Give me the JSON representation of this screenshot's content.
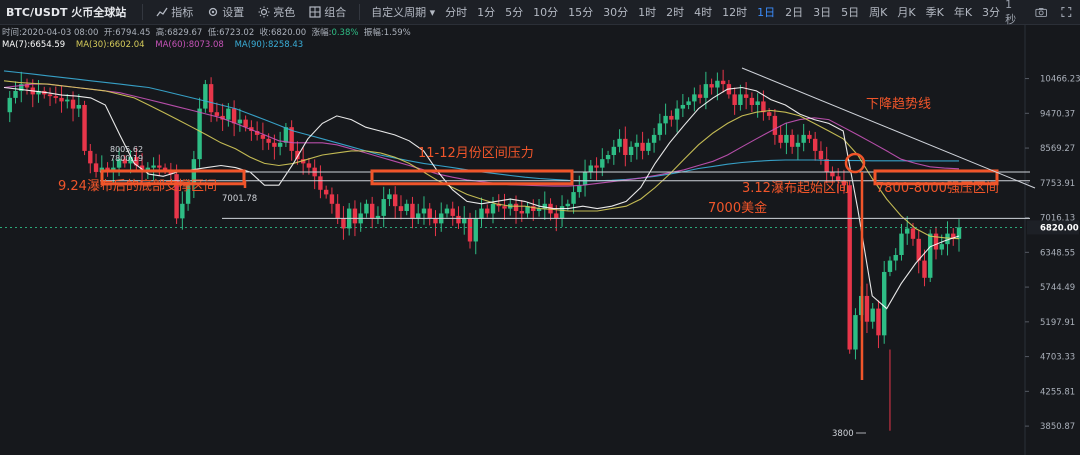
{
  "toolbar": {
    "symbol": "BTC/USDT 火币全球站",
    "indicators": "指标",
    "settings": "设置",
    "theme": "亮色",
    "combo": "组合",
    "custom_period": "自定义周期",
    "periods": [
      "分时",
      "1分",
      "5分",
      "10分",
      "15分",
      "30分",
      "1时",
      "2时",
      "4时",
      "12时",
      "1日",
      "2日",
      "3日",
      "5日",
      "周K",
      "月K",
      "季K",
      "年K",
      "3分"
    ],
    "active_period": "1日",
    "interval": "1秒"
  },
  "info": {
    "time": "时间:2020-04-03 08:00",
    "open": "开:6794.45",
    "high": "高:6829.67",
    "low": "低:6723.02",
    "close": "收:6820.00",
    "change_label": "涨幅:",
    "change": "0.38%",
    "amplitude": "振幅:1.59%"
  },
  "ma": [
    {
      "label": "MA(7):6654.59",
      "color": "#ffffff"
    },
    {
      "label": "MA(30):6602.04",
      "color": "#d6cc5a"
    },
    {
      "label": "MA(60):8073.08",
      "color": "#c653b8"
    },
    {
      "label": "MA(90):8258.43",
      "color": "#3aaed8"
    }
  ],
  "colors": {
    "up": "#2ebd85",
    "down": "#e8364a",
    "annotation": "#f0552a",
    "current_price": "#2ebd85"
  },
  "chart_data": {
    "type": "candlestick",
    "y_axis_ticks": [
      "10466.23",
      "9470.37",
      "8569.27",
      "7753.91",
      "7016.13",
      "6348.55",
      "5744.49",
      "5197.91",
      "4703.33",
      "4255.81",
      "3850.87"
    ],
    "current_price": "6820.00",
    "axis_scale": "log",
    "ylim": [
      3700,
      11200
    ],
    "ma7": [
      10200,
      10150,
      10100,
      10050,
      9980,
      9950,
      9900,
      9700,
      8900,
      8200,
      7950,
      7900,
      8000,
      8050,
      8100,
      8150,
      8100,
      8000,
      7700,
      7700,
      8200,
      8800,
      9200,
      9400,
      9300,
      9100,
      9000,
      8900,
      8750,
      8500,
      8000,
      7600,
      7350,
      7300,
      7350,
      7400,
      7350,
      7250,
      7200,
      7200,
      7250,
      7200,
      7250,
      7350,
      7650,
      8200,
      8700,
      9150,
      9600,
      9900,
      10150,
      10200,
      10100,
      9850,
      9700,
      9450,
      9300,
      9200,
      9000,
      7200,
      5600,
      5400,
      5800,
      6150,
      6450,
      6560,
      6654
    ],
    "ma30": [
      10400,
      10350,
      10320,
      10300,
      10250,
      10200,
      10150,
      10100,
      10000,
      9900,
      9700,
      9500,
      9300,
      9100,
      8900,
      8700,
      8550,
      8350,
      8200,
      8150,
      8200,
      8300,
      8400,
      8450,
      8500,
      8500,
      8450,
      8350,
      8200,
      8000,
      7800,
      7650,
      7500,
      7400,
      7300,
      7250,
      7250,
      7200,
      7180,
      7150,
      7150,
      7150,
      7200,
      7250,
      7400,
      7650,
      7950,
      8300,
      8650,
      8950,
      9200,
      9400,
      9500,
      9550,
      9500,
      9400,
      9200,
      9000,
      8800,
      8400,
      7850,
      7400,
      7050,
      6800,
      6650,
      6620,
      6602
    ],
    "ma60": [
      10200,
      10250,
      10300,
      10300,
      10250,
      10200,
      10150,
      10100,
      10050,
      9950,
      9850,
      9750,
      9650,
      9550,
      9450,
      9350,
      9200,
      9050,
      8900,
      8750,
      8700,
      8700,
      8700,
      8650,
      8550,
      8450,
      8350,
      8250,
      8150,
      8050,
      7950,
      7880,
      7820,
      7780,
      7740,
      7710,
      7700,
      7690,
      7680,
      7680,
      7700,
      7740,
      7780,
      7820,
      7860,
      7920,
      7980,
      8050,
      8150,
      8250,
      8400,
      8600,
      8800,
      9000,
      9200,
      9300,
      9350,
      9300,
      9100,
      8900,
      8700,
      8500,
      8300,
      8200,
      8120,
      8090,
      8073
    ],
    "ma90": [
      10700,
      10650,
      10600,
      10550,
      10500,
      10450,
      10400,
      10350,
      10300,
      10250,
      10200,
      10100,
      10000,
      9900,
      9800,
      9700,
      9600,
      9450,
      9300,
      9150,
      9000,
      8900,
      8800,
      8700,
      8600,
      8500,
      8400,
      8330,
      8260,
      8200,
      8150,
      8100,
      8050,
      8000,
      7960,
      7920,
      7880,
      7850,
      7830,
      7810,
      7800,
      7800,
      7810,
      7830,
      7860,
      7900,
      7950,
      8010,
      8080,
      8130,
      8180,
      8220,
      8250,
      8270,
      8280,
      8280,
      8280,
      8270,
      8270,
      8265,
      8260,
      8260,
      8260,
      8258,
      8258,
      8258,
      8258
    ],
    "price_path": [
      9500,
      9900,
      10100,
      10300,
      10200,
      10000,
      10100,
      10000,
      9950,
      9900,
      9800,
      9850,
      9600,
      9700,
      8500,
      8200,
      8000,
      8100,
      8050,
      8100,
      8300,
      8200,
      8350,
      8150,
      8000,
      8100,
      8150,
      8100,
      8050,
      7950,
      7000,
      7300,
      7700,
      8300,
      9600,
      10300,
      9500,
      9400,
      9300,
      9600,
      9200,
      9300,
      9100,
      9000,
      8900,
      8800,
      8700,
      8600,
      8700,
      9100,
      8500,
      8300,
      8200,
      8100,
      7900,
      7600,
      7500,
      7300,
      7000,
      6800,
      7200,
      6900,
      7100,
      7300,
      7000,
      7050,
      7400,
      7500,
      7250,
      7150,
      7300,
      7000,
      7100,
      7200,
      7000,
      6900,
      7100,
      7200,
      7050,
      6900,
      7000,
      6550,
      7000,
      7200,
      7100,
      7300,
      7250,
      7200,
      7300,
      7150,
      7100,
      7250,
      7150,
      7200,
      7300,
      7100,
      7000,
      7250,
      7300,
      7550,
      7700,
      8000,
      8150,
      8100,
      8300,
      8400,
      8600,
      8800,
      8400,
      8600,
      8700,
      8500,
      8700,
      8900,
      9200,
      9400,
      9300,
      9600,
      9700,
      9800,
      10000,
      9900,
      10300,
      10200,
      10400,
      10300,
      10000,
      9700,
      10000,
      9900,
      9700,
      9800,
      9500,
      9400,
      8900,
      8700,
      8900,
      8600,
      8700,
      8900,
      8800,
      8500,
      8300,
      8000,
      7900,
      7800,
      7700,
      4800,
      5300,
      5600,
      5200,
      5400,
      5000,
      6000,
      6200,
      6300,
      6700,
      6800,
      6600,
      6200,
      5900,
      6700,
      6400,
      6500,
      6700,
      6600,
      6820
    ],
    "levels": [
      {
        "name": "7800-8000 zone upper",
        "value": 8000
      },
      {
        "name": "7800-8000 zone lower",
        "value": 7800
      },
      {
        "name": "7000 USD",
        "value": 7000
      }
    ],
    "extremes": {
      "high_labels": [
        "8005.62",
        "7800.19"
      ],
      "low_labels": [
        "7001.78",
        "3800"
      ]
    },
    "annotations": [
      "9.24瀑布后的底部支撑区间",
      "11-12月份区间压力",
      "下降趋势线",
      "3.12瀑布起始区间",
      "7800-8000强压区间",
      "7000美金"
    ]
  }
}
